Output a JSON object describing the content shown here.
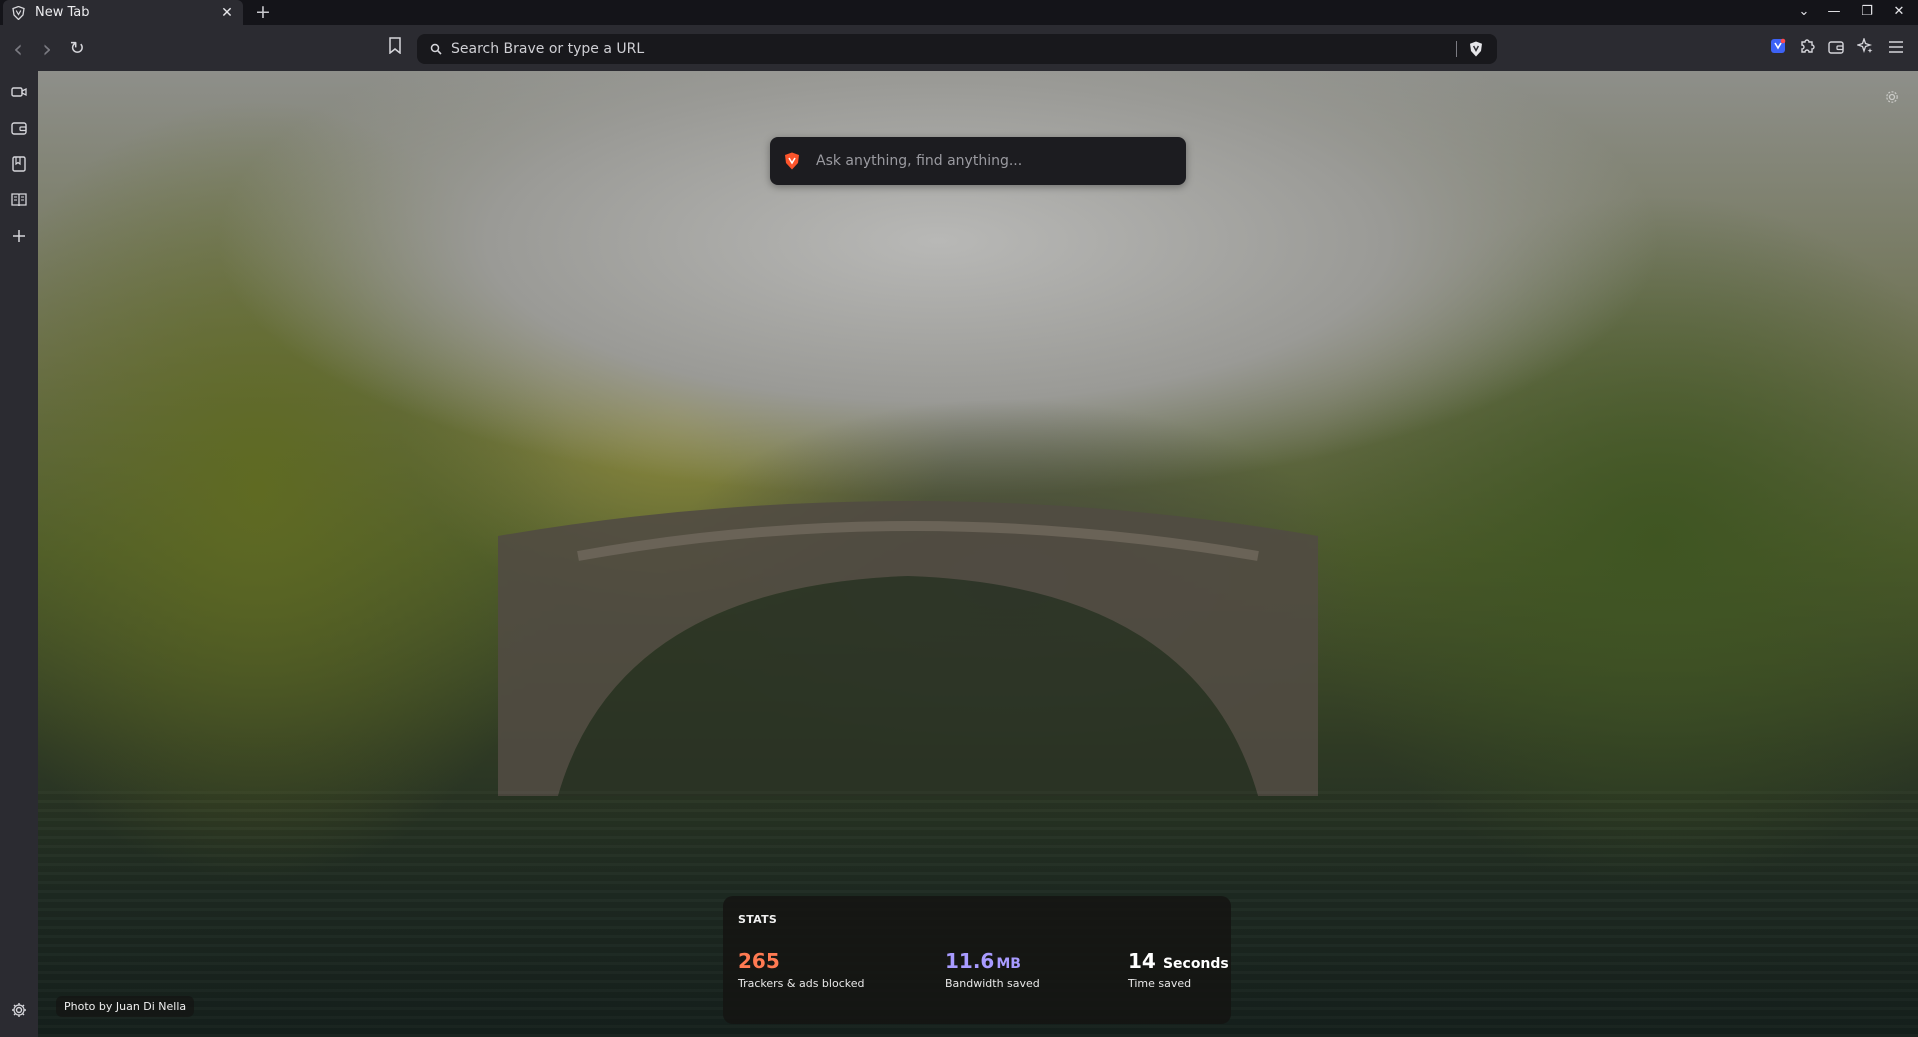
{
  "window": {
    "tab": {
      "title": "New Tab",
      "icon": "brave-shield-icon",
      "close": "✕"
    },
    "new_tab": "+",
    "controls": {
      "menu": "⌄",
      "minimize": "—",
      "restore": "❐",
      "close": "✕"
    }
  },
  "toolbar": {
    "back": "‹",
    "forward": "›",
    "reload": "↻",
    "urlbar_placeholder": "Search Brave or type a URL"
  },
  "ntp": {
    "search_placeholder": "Ask anything, find anything...",
    "stats": {
      "label": "STATS",
      "trackers": {
        "value": "265",
        "desc": "Trackers & ads blocked"
      },
      "bandwidth": {
        "value": "11.6",
        "unit": "MB",
        "desc": "Bandwidth saved"
      },
      "time": {
        "value": "14",
        "unit": "Seconds",
        "desc": "Time saved"
      }
    },
    "photo_credit": "Photo by Juan Di Nella"
  },
  "colors": {
    "trackers": "#ff7a52",
    "bandwidth": "#a89bff",
    "brave_orange": "#fb542b"
  }
}
